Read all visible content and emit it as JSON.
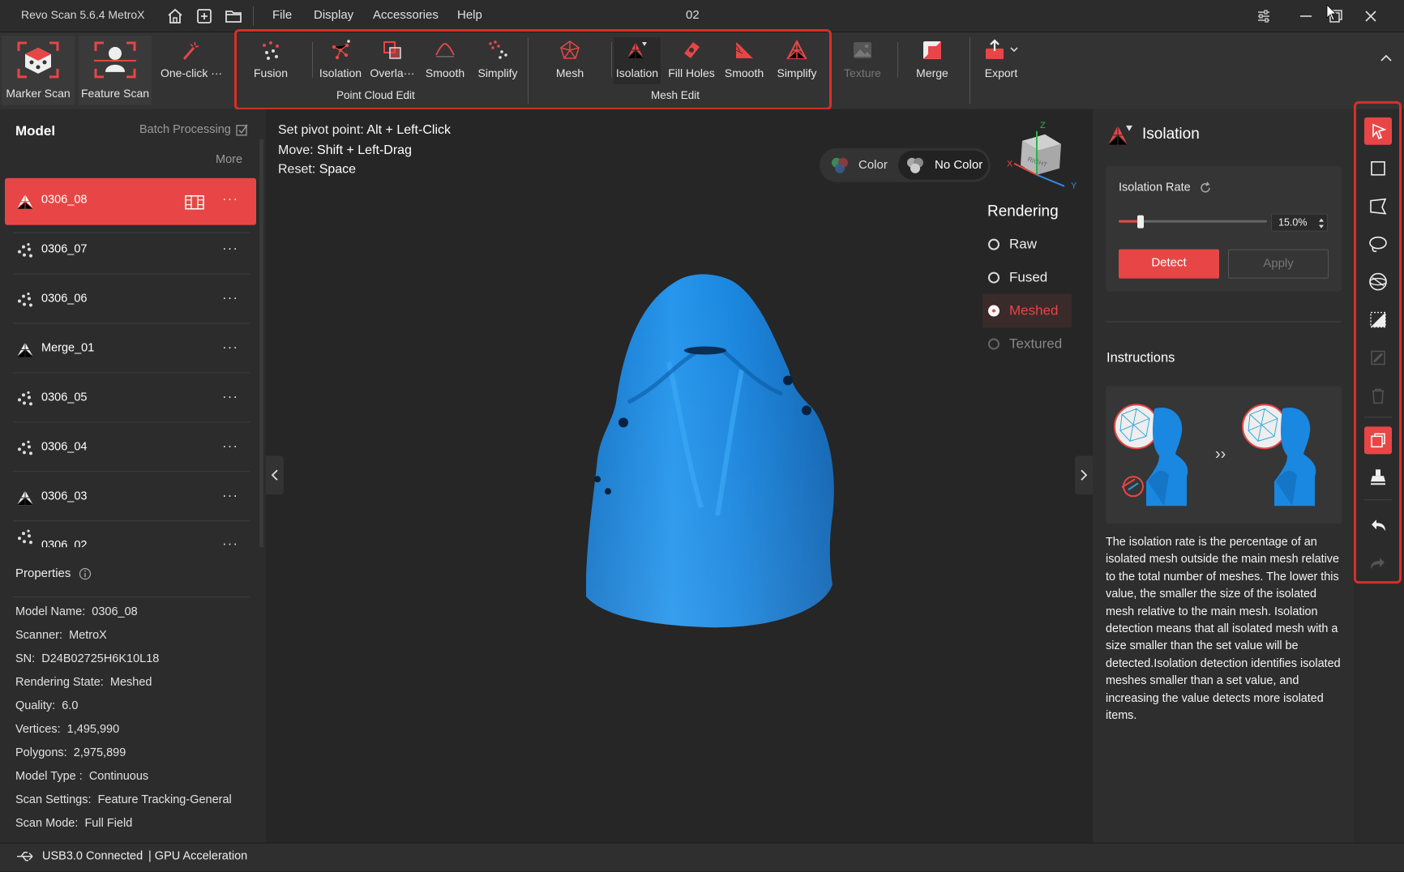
{
  "app": {
    "title": "Revo Scan 5.6.4 MetroX",
    "project": "02"
  },
  "menu": [
    "File",
    "Display",
    "Accessories",
    "Help"
  ],
  "ribbon": {
    "marker_scan": "Marker Scan",
    "feature_scan": "Feature Scan",
    "one_click": "One-click ···",
    "point_cloud_tools": [
      "Fusion",
      "Isolation",
      "Overla···",
      "Smooth",
      "Simplify"
    ],
    "point_cloud_group": "Point Cloud Edit",
    "mesh_tools": [
      "Mesh",
      "Isolation",
      "Fill Holes",
      "Smooth",
      "Simplify"
    ],
    "mesh_group": "Mesh Edit",
    "texture": "Texture",
    "merge": "Merge",
    "export": "Export"
  },
  "left": {
    "title": "Model",
    "batch": "Batch Processing",
    "more": "More",
    "models": [
      {
        "name": "0306_08",
        "kind": "mesh",
        "selected": true
      },
      {
        "name": "0306_07",
        "kind": "cloud"
      },
      {
        "name": "0306_06",
        "kind": "cloud"
      },
      {
        "name": "Merge_01",
        "kind": "mesh"
      },
      {
        "name": "0306_05",
        "kind": "cloud"
      },
      {
        "name": "0306_04",
        "kind": "cloud"
      },
      {
        "name": "0306_03",
        "kind": "mesh"
      },
      {
        "name": "0306_02",
        "kind": "cloud"
      }
    ],
    "properties_title": "Properties",
    "properties": [
      {
        "k": "Model Name:",
        "v": "0306_08"
      },
      {
        "k": "Scanner:",
        "v": "MetroX"
      },
      {
        "k": "SN:",
        "v": "D24B02725H6K10L18"
      },
      {
        "k": "Rendering State:",
        "v": "Meshed"
      },
      {
        "k": "Quality:",
        "v": "6.0"
      },
      {
        "k": "Vertices:",
        "v": "1,495,990"
      },
      {
        "k": "Polygons:",
        "v": "2,975,899"
      },
      {
        "k": "Model Type :",
        "v": "Continuous"
      },
      {
        "k": "Scan Settings:",
        "v": "Feature Tracking-General"
      },
      {
        "k": "Scan Mode:",
        "v": "Full Field"
      }
    ]
  },
  "viewport": {
    "hints": [
      {
        "k": "Set pivot point:",
        "v": "Alt + Left-Click"
      },
      {
        "k": "Move:",
        "v": "Shift + Left-Drag"
      },
      {
        "k": "Reset:",
        "v": "Space"
      }
    ],
    "color": "Color",
    "no_color": "No Color",
    "rendering_title": "Rendering",
    "rendering": [
      "Raw",
      "Fused",
      "Meshed",
      "Textured"
    ],
    "rendering_selected": "Meshed",
    "axes": {
      "z": "Z",
      "y": "Y",
      "x": "X",
      "face": "RIGHT"
    }
  },
  "right": {
    "title": "Isolation",
    "rate_label": "Isolation Rate",
    "rate_value": "15.0%",
    "rate_fraction": 0.15,
    "detect": "Detect",
    "apply": "Apply",
    "instructions_title": "Instructions",
    "instructions_text": "The isolation rate is the percentage of an isolated mesh outside the main mesh relative to the total number of meshes. The lower this value, the smaller the size of the isolated mesh relative to the main mesh. Isolation detection means that all isolated mesh with a size smaller than the set value will be detected.Isolation detection identifies isolated meshes smaller than a set value, and increasing the value detects more isolated items."
  },
  "status": {
    "usb": "USB3.0 Connected",
    "gpu": "| GPU Acceleration"
  },
  "colors": {
    "accent": "#e84646",
    "highlight": "#d92f27",
    "model": "#1f8ee6"
  }
}
